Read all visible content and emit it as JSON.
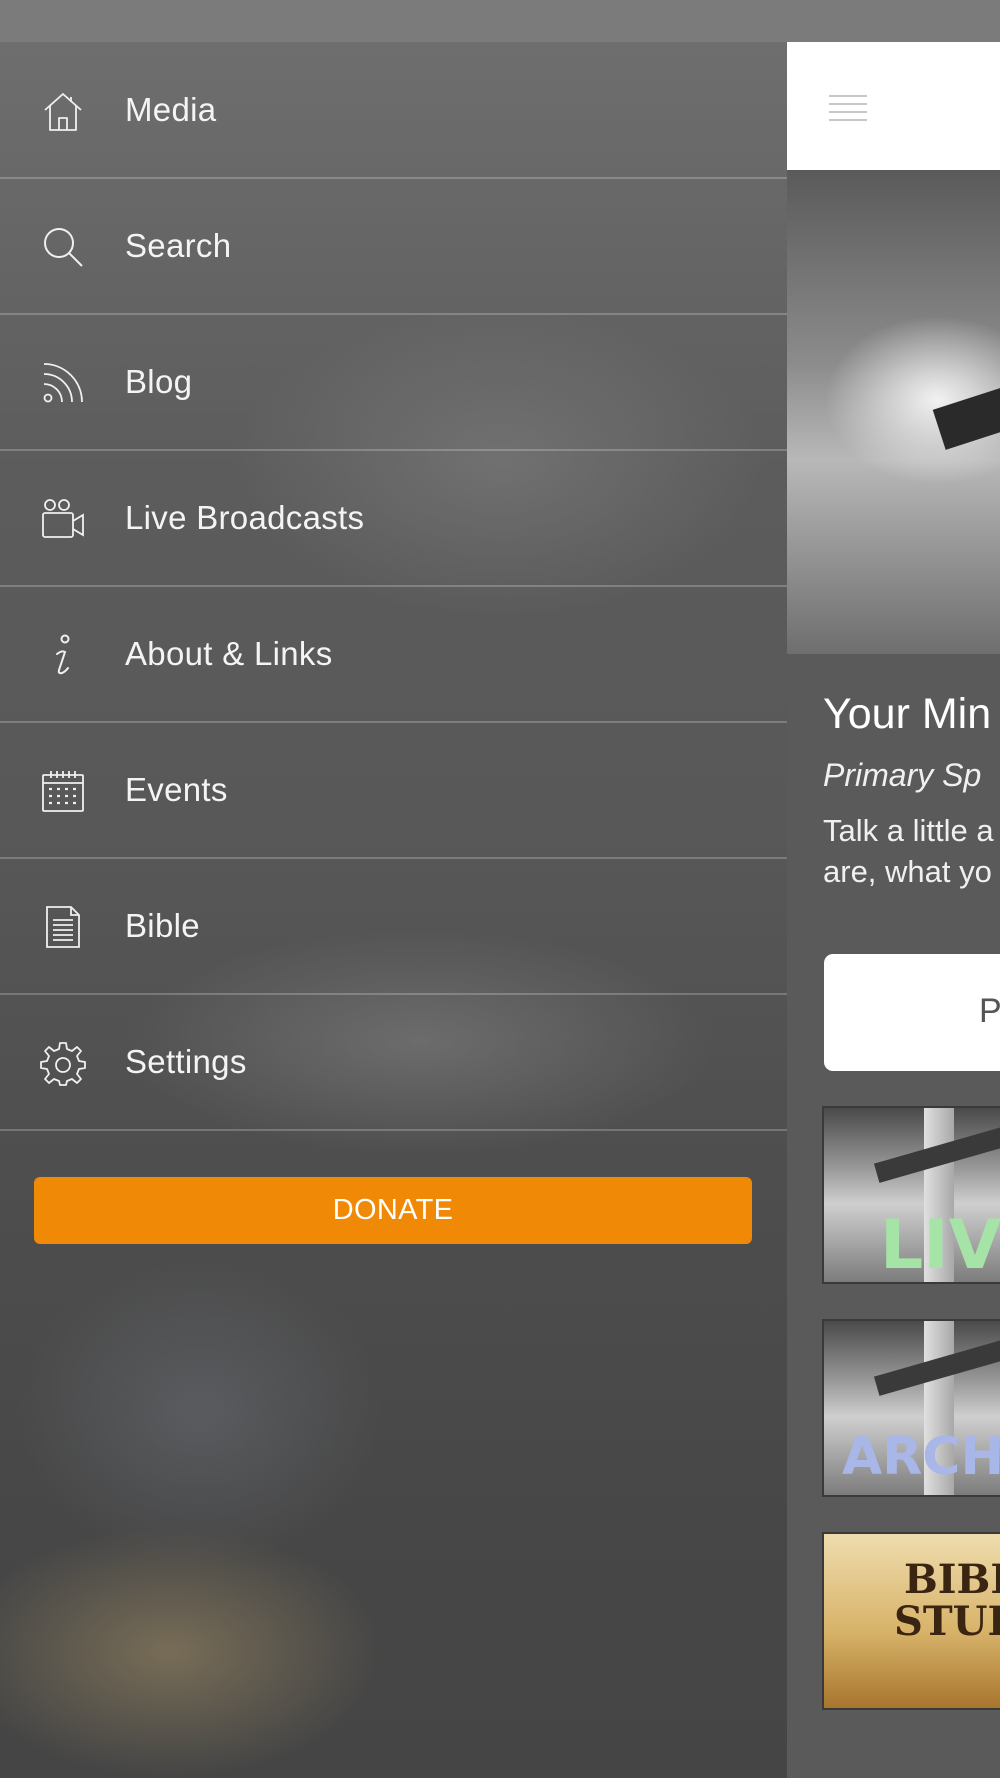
{
  "menu": {
    "items": [
      {
        "label": "Media",
        "icon": "home-icon"
      },
      {
        "label": "Search",
        "icon": "search-icon"
      },
      {
        "label": "Blog",
        "icon": "rss-icon"
      },
      {
        "label": "Live Broadcasts",
        "icon": "video-camera-icon"
      },
      {
        "label": "About & Links",
        "icon": "info-icon"
      },
      {
        "label": "Events",
        "icon": "calendar-icon"
      },
      {
        "label": "Bible",
        "icon": "document-icon"
      },
      {
        "label": "Settings",
        "icon": "gear-icon"
      }
    ],
    "donate_label": "DONATE",
    "donate_color": "#f08a06"
  },
  "main": {
    "title": "Your Min",
    "subtitle": "Primary Sp",
    "description_line1": "Talk a little a",
    "description_line2": "are, what yo",
    "button_label": "P",
    "tiles": [
      {
        "label": "LIV",
        "color": "#a6e3a6"
      },
      {
        "label": "ARCH",
        "color": "#a9b6e8"
      },
      {
        "label_line1": "BIBL",
        "label_line2": "STUI"
      }
    ]
  }
}
